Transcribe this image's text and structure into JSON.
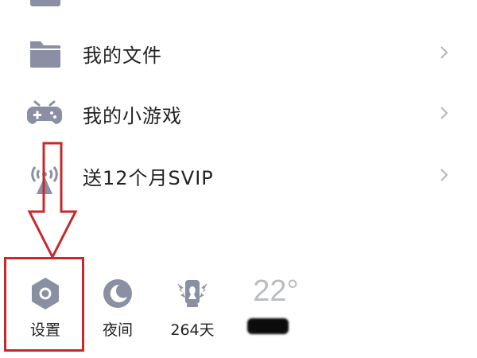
{
  "menu": {
    "cut_label": "",
    "items": [
      {
        "label": "我的文件",
        "icon": "folder-icon"
      },
      {
        "label": "我的小游戏",
        "icon": "gamepad-icon"
      },
      {
        "label": "送12个月SVIP",
        "icon": "broadcast-tower-icon"
      }
    ]
  },
  "toolbar": {
    "items": [
      {
        "label": "设置",
        "icon": "hexagon-settings-icon"
      },
      {
        "label": "夜间",
        "icon": "moon-icon"
      },
      {
        "label": "264天",
        "icon": "winged-badge-icon"
      }
    ],
    "weather": {
      "temperature": "22°"
    }
  },
  "colors": {
    "icon_gray": "#8a8fa3",
    "highlight_red": "#c8282a",
    "chevron": "#b5b5b5",
    "temp_text": "#b9bcc6"
  }
}
